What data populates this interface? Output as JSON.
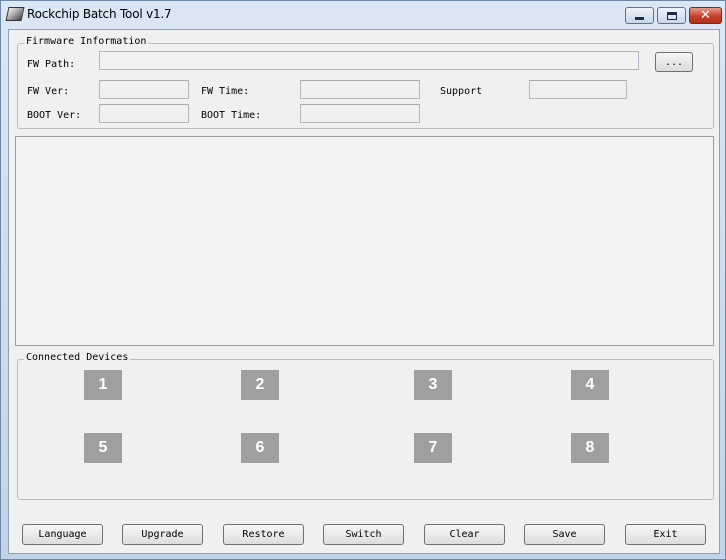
{
  "window": {
    "title": "Rockchip Batch Tool v1.7",
    "close_glyph": "✕"
  },
  "firmware": {
    "legend": "Firmware Information",
    "fw_path_label": "FW Path:",
    "fw_path_value": "",
    "browse_label": "...",
    "fw_ver_label": "FW Ver:",
    "fw_ver_value": "",
    "fw_time_label": "FW Time:",
    "fw_time_value": "",
    "support_label": "Support",
    "support_value": "",
    "boot_ver_label": "BOOT Ver:",
    "boot_ver_value": "",
    "boot_time_label": "BOOT Time:",
    "boot_time_value": ""
  },
  "log": {
    "text": ""
  },
  "devices": {
    "legend": "Connected Devices",
    "slots": [
      "1",
      "2",
      "3",
      "4",
      "5",
      "6",
      "7",
      "8"
    ]
  },
  "toolbar": {
    "language_label": "Language",
    "upgrade_label": "Upgrade",
    "restore_label": "Restore",
    "switch_label": "Switch",
    "clear_label": "Clear",
    "save_label": "Save",
    "exit_label": "Exit"
  }
}
